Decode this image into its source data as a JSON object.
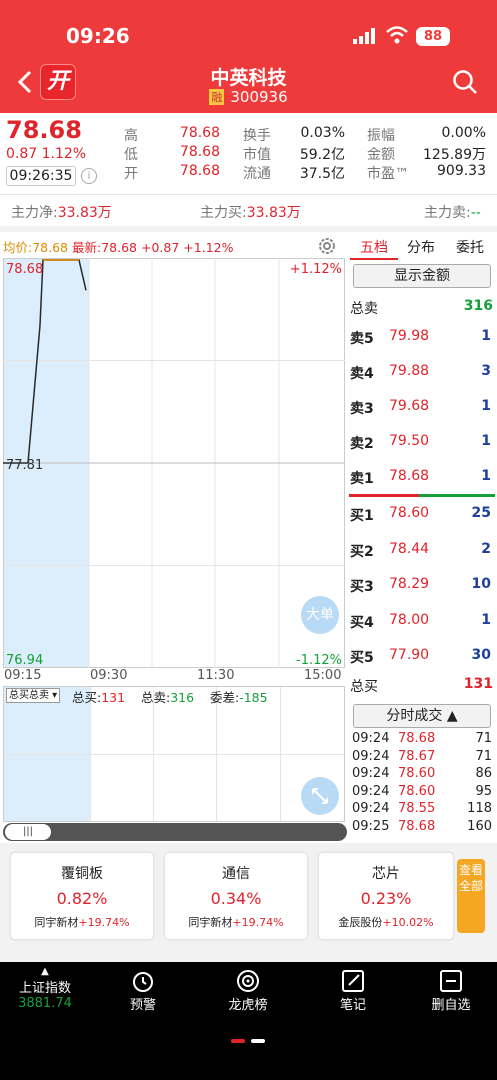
{
  "status": {
    "time": "09:26",
    "battery": "88"
  },
  "header": {
    "logo": "开",
    "title": "中英科技",
    "rong": "融",
    "code": "300936"
  },
  "quote": {
    "price": "78.68",
    "change": "0.87",
    "pct": "1.12%",
    "time": "09:26:35",
    "fields": [
      {
        "l": "高",
        "v": "78.68",
        "l2": "换手",
        "v2": "0.03%",
        "l3": "振幅",
        "v3": "0.00%"
      },
      {
        "l": "低",
        "v": "78.68",
        "l2": "市值",
        "v2": "59.2亿",
        "l3": "金额",
        "v3": "125.89万"
      },
      {
        "l": "开",
        "v": "78.68",
        "l2": "流通",
        "v2": "37.5亿",
        "l3": "市盈™",
        "v3": "909.33"
      }
    ]
  },
  "flow": {
    "net_label": "主力净:",
    "net": "33.83万",
    "buy_label": "主力买:",
    "buy": "33.83万",
    "sell_label": "主力卖:",
    "sell": "--"
  },
  "chart_info": {
    "avg_label": "均价:",
    "avg": "78.68",
    "latest_label": "最新:",
    "latest": "78.68",
    "chg": "+0.87",
    "pct": "+1.12%"
  },
  "chart_data": {
    "type": "line",
    "x_ticks": [
      "09:15",
      "09:30",
      "11:30",
      "15:00"
    ],
    "y_left": [
      "78.68",
      "77.81",
      "76.94"
    ],
    "y_right": [
      "+1.12%",
      "-1.12%"
    ],
    "x": [
      "09:15",
      "09:20",
      "09:21",
      "09:22",
      "09:23",
      "09:24",
      "09:25",
      "09:26"
    ],
    "values": [
      77.81,
      77.81,
      77.81,
      78.4,
      78.68,
      78.68,
      78.68,
      78.55
    ],
    "ylim": [
      76.94,
      78.68
    ]
  },
  "big_order": "大单",
  "vol": {
    "select": "总买总卖",
    "buy_label": "总买:",
    "buy": "131",
    "sell_label": "总卖:",
    "sell": "316",
    "diff_label": "委差:",
    "diff": "-185"
  },
  "tabs": [
    "五档",
    "分布",
    "委托"
  ],
  "show_amount": "显示金额",
  "ob": {
    "total_sell_label": "总卖",
    "total_sell": "316",
    "total_buy_label": "总买",
    "total_buy": "131",
    "asks": [
      {
        "l": "卖5",
        "p": "79.98",
        "q": "1"
      },
      {
        "l": "卖4",
        "p": "79.88",
        "q": "3"
      },
      {
        "l": "卖3",
        "p": "79.68",
        "q": "1"
      },
      {
        "l": "卖2",
        "p": "79.50",
        "q": "1"
      },
      {
        "l": "卖1",
        "p": "78.68",
        "q": "1"
      }
    ],
    "bids": [
      {
        "l": "买1",
        "p": "78.60",
        "q": "25"
      },
      {
        "l": "买2",
        "p": "78.44",
        "q": "2"
      },
      {
        "l": "买3",
        "p": "78.29",
        "q": "10"
      },
      {
        "l": "买4",
        "p": "78.00",
        "q": "1"
      },
      {
        "l": "买5",
        "p": "77.90",
        "q": "30"
      }
    ]
  },
  "ticks_label": "分时成交",
  "ticks": [
    {
      "t": "09:24",
      "p": "78.68",
      "q": "71"
    },
    {
      "t": "09:24",
      "p": "78.67",
      "q": "71"
    },
    {
      "t": "09:24",
      "p": "78.60",
      "q": "86"
    },
    {
      "t": "09:24",
      "p": "78.60",
      "q": "95"
    },
    {
      "t": "09:24",
      "p": "78.55",
      "q": "118"
    },
    {
      "t": "09:25",
      "p": "78.68",
      "q": "160"
    }
  ],
  "sectors": [
    {
      "n": "覆铜板",
      "p": "0.82%",
      "s": "同宇新材",
      "sp": "+19.74%"
    },
    {
      "n": "通信",
      "p": "0.34%",
      "s": "同宇新材",
      "sp": "+19.74%"
    },
    {
      "n": "芯片",
      "p": "0.23%",
      "s": "金辰股份",
      "sp": "+10.02%"
    }
  ],
  "view_all": "查看全部",
  "nav": {
    "index_name": "上证指数",
    "index_val": "3881.74",
    "items": [
      "预警",
      "龙虎榜",
      "笔记",
      "删自选"
    ]
  },
  "colors": {
    "brand": "#ee3a3a",
    "up": "#e0242b",
    "down": "#13a03a",
    "buy_qty": "#1e3f9c"
  }
}
